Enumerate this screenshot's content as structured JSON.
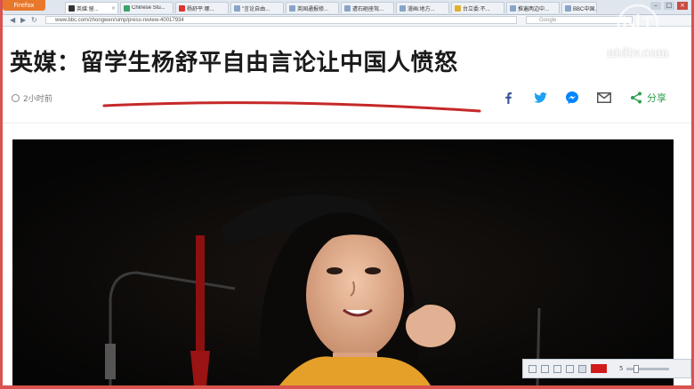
{
  "browser": {
    "app_button": "Firefox",
    "tabs": [
      {
        "label": "英媒:留..."
      },
      {
        "label": "Chinese Stu..."
      },
      {
        "label": "杨舒平:哪..."
      },
      {
        "label": "\"言论自由..."
      },
      {
        "label": "英国通报修..."
      },
      {
        "label": "遭石砸座驾..."
      },
      {
        "label": "漫画:地方..."
      },
      {
        "label": "台立委:不..."
      },
      {
        "label": "推遍两边中..."
      },
      {
        "label": "BBC中国..."
      }
    ],
    "url": "www.bbc.com/zhongwen/simp/press-review-40017934",
    "search_placeholder": "Google",
    "window_controls": [
      "–",
      "□",
      "×"
    ]
  },
  "article": {
    "headline": "英媒：留学生杨舒平自由言论让中国人愤怒",
    "time_ago": "2小时前",
    "share": {
      "icons": [
        "facebook-icon",
        "twitter-icon",
        "messenger-icon",
        "email-icon",
        "share-icon"
      ],
      "label": "分享"
    },
    "annotation_color": "#c62828"
  },
  "toolbar": {
    "brush_color": "#d01b1b",
    "size_value": "5"
  },
  "watermark": {
    "text": "ntdtv.com"
  },
  "colors": {
    "frame": "#d9534f",
    "share_green": "#2e9e4f",
    "facebook": "#3b5998",
    "twitter": "#1da1f2",
    "messenger": "#0084ff"
  }
}
